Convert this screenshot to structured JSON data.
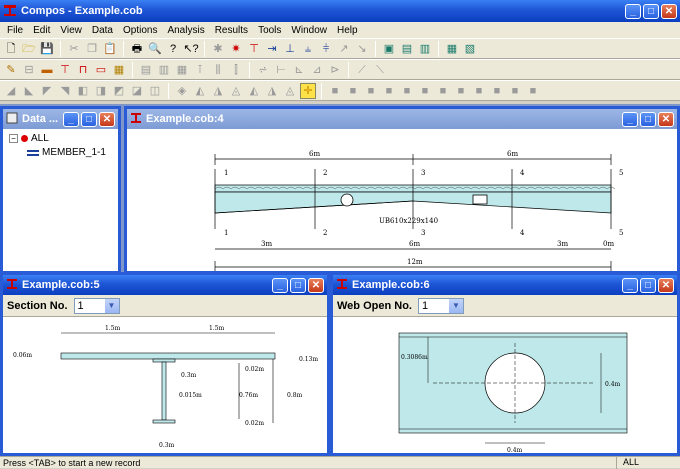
{
  "app": {
    "title": "Compos - Example.cob"
  },
  "menu": [
    "File",
    "Edit",
    "View",
    "Data",
    "Options",
    "Analysis",
    "Results",
    "Tools",
    "Window",
    "Help"
  ],
  "tree": {
    "title": "Data ...",
    "root": "ALL",
    "child": "MEMBER_1-1"
  },
  "win4": {
    "title": "Example.cob:4",
    "beam_label": "UB610x229x140",
    "top_dims": [
      "6m",
      "6m"
    ],
    "bottom_dims": [
      "3m",
      "6m",
      "3m",
      "0m"
    ],
    "total": "12m",
    "sections": [
      "1",
      "2",
      "3",
      "4",
      "5"
    ]
  },
  "win5": {
    "title": "Example.cob:5",
    "field_label": "Section No.",
    "field_value": "1",
    "dims": {
      "slab_left": "1.5m",
      "slab_right": "1.5m",
      "slab_thk": "0.06m",
      "slab_depth": "0.13m",
      "flange_w_top": "0.3m",
      "web": "0.015m",
      "fl_top": "0.02m",
      "depth": "0.76m",
      "total": "0.8m",
      "fl_bot": "0.02m",
      "flange_w_bot": "0.3m"
    }
  },
  "win6": {
    "title": "Example.cob:6",
    "field_label": "Web Open No.",
    "field_value": "1",
    "dims": {
      "offset": "0.3086m",
      "height": "0.4m",
      "width": "0.4m"
    }
  },
  "status": {
    "text": "Press <TAB> to start a new record",
    "cell": "ALL"
  },
  "colors": {
    "steel": "#bfe8ea",
    "titlebar": "#1f56d6",
    "mdi": "#7f96c9"
  }
}
